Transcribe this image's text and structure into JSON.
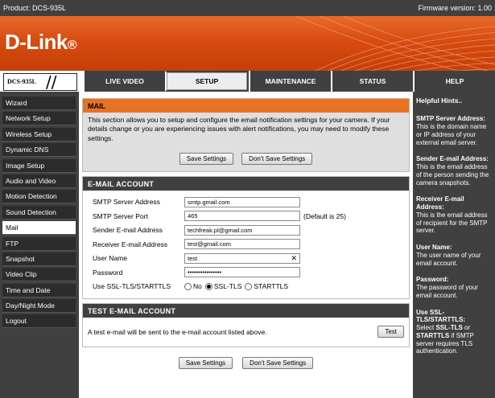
{
  "header": {
    "product": "Product: DCS-935L",
    "firmware": "Firmware version: 1.00"
  },
  "brand": {
    "logo": "D-Link",
    "model": "DCS-935L"
  },
  "tabs": [
    "LIVE VIDEO",
    "SETUP",
    "MAINTENANCE",
    "STATUS",
    "HELP"
  ],
  "sidebar": [
    "Wizard",
    "Network Setup",
    "Wireless Setup",
    "Dynamic DNS",
    "Image Setup",
    "Audio and Video",
    "Motion Detection",
    "Sound Detection",
    "Mail",
    "FTP",
    "Snapshot",
    "Video Clip",
    "Time and Date",
    "Day/Night Mode",
    "Logout"
  ],
  "mail": {
    "title": "MAIL",
    "intro": "This section allows you to setup and configure the email notification settings for your camera. If your details change or you are experiencing issues with alert notifications, you may need to modify these settings.",
    "save": "Save Settings",
    "dont_save": "Don't Save Settings"
  },
  "account": {
    "title": "E-MAIL ACCOUNT",
    "fields": [
      {
        "label": "SMTP Server Address",
        "value": "smtp.gmail.com"
      },
      {
        "label": "SMTP Server Port",
        "value": "465",
        "hint": "(Default is 25)"
      },
      {
        "label": "Sender E-mail Address",
        "value": "techfreak.pl@gmail.com"
      },
      {
        "label": "Receiver E-mail Address",
        "value": "test@gmail.com"
      },
      {
        "label": "User Name",
        "value": "test"
      },
      {
        "label": "Password",
        "value": "••••••••••••••••"
      }
    ],
    "ssl_label": "Use SSL-TLS/STARTTLS",
    "ssl_options": [
      "No",
      "SSL-TLS",
      "STARTTLS"
    ],
    "ssl_selected": "SSL-TLS"
  },
  "test": {
    "title": "TEST E-MAIL ACCOUNT",
    "text": "A test e-mail will be sent to the e-mail account listed above.",
    "button": "Test"
  },
  "footer": {
    "save": "Save Settings",
    "dont_save": "Don't Save Settings"
  },
  "help": {
    "title": "Helpful Hints..",
    "items": [
      {
        "term": "SMTP Server Address:",
        "text": "This is the domain name or IP address of your external email server."
      },
      {
        "term": "Sender E-mail Address:",
        "text": "This is the email address of the person sending the camera snapshots."
      },
      {
        "term": "Receiver E-mail Address:",
        "text": "This is the email address of recipient for the SMTP server."
      },
      {
        "term": "User Name:",
        "text": "The user name of your email account."
      },
      {
        "term": "Password:",
        "text": "The password of your email account."
      }
    ],
    "ssl_term": "Use SSL-TLS/STARTTLS:",
    "ssl_pre": "Select ",
    "ssl_opt1": "SSL-TLS",
    "ssl_mid": " or ",
    "ssl_opt2": "STARTTLS",
    "ssl_post": " if SMTP server requires TLS authentication."
  }
}
